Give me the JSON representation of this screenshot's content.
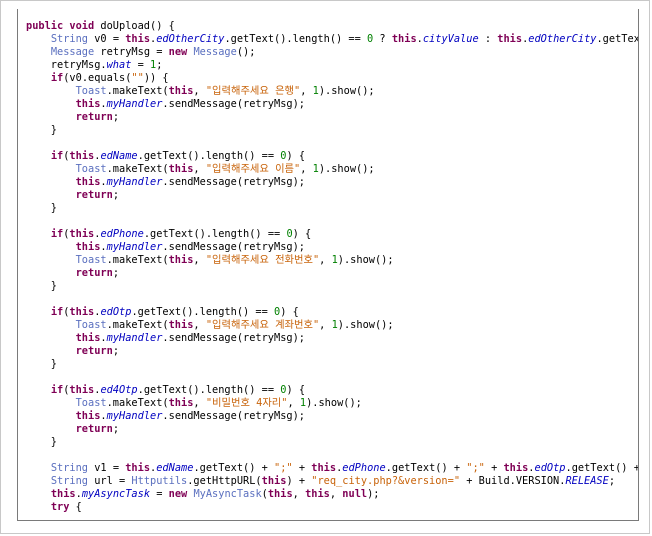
{
  "code_view": {
    "lines": [
      [
        {
          "c": "kw",
          "t": "public void"
        },
        {
          "c": "pl",
          "t": " doUpload() {"
        }
      ],
      [
        {
          "c": "pl",
          "t": "    "
        },
        {
          "c": "ty",
          "t": "String"
        },
        {
          "c": "pl",
          "t": " v0 = "
        },
        {
          "c": "kw",
          "t": "this"
        },
        {
          "c": "pl",
          "t": "."
        },
        {
          "c": "fld",
          "t": "edOtherCity"
        },
        {
          "c": "pl",
          "t": ".getText().length() == "
        },
        {
          "c": "num",
          "t": "0"
        },
        {
          "c": "pl",
          "t": " ? "
        },
        {
          "c": "kw",
          "t": "this"
        },
        {
          "c": "pl",
          "t": "."
        },
        {
          "c": "fld",
          "t": "cityValue"
        },
        {
          "c": "pl",
          "t": " : "
        },
        {
          "c": "kw",
          "t": "this"
        },
        {
          "c": "pl",
          "t": "."
        },
        {
          "c": "fld",
          "t": "edOtherCity"
        },
        {
          "c": "pl",
          "t": ".getText()"
        }
      ],
      [
        {
          "c": "pl",
          "t": "    "
        },
        {
          "c": "ty",
          "t": "Message"
        },
        {
          "c": "pl",
          "t": " retryMsg = "
        },
        {
          "c": "kw",
          "t": "new"
        },
        {
          "c": "pl",
          "t": " "
        },
        {
          "c": "ty",
          "t": "Message"
        },
        {
          "c": "pl",
          "t": "();"
        }
      ],
      [
        {
          "c": "pl",
          "t": "    retryMsg."
        },
        {
          "c": "fld",
          "t": "what"
        },
        {
          "c": "pl",
          "t": " = "
        },
        {
          "c": "num",
          "t": "1"
        },
        {
          "c": "pl",
          "t": ";"
        }
      ],
      [
        {
          "c": "pl",
          "t": "    "
        },
        {
          "c": "kw",
          "t": "if"
        },
        {
          "c": "pl",
          "t": "(v0.equals("
        },
        {
          "c": "str",
          "t": "\"\""
        },
        {
          "c": "pl",
          "t": ")) {"
        }
      ],
      [
        {
          "c": "pl",
          "t": "        "
        },
        {
          "c": "ty",
          "t": "Toast"
        },
        {
          "c": "pl",
          "t": ".makeText("
        },
        {
          "c": "kw",
          "t": "this"
        },
        {
          "c": "pl",
          "t": ", "
        },
        {
          "c": "str",
          "t": "\"입력해주세요 은행\""
        },
        {
          "c": "pl",
          "t": ", "
        },
        {
          "c": "num",
          "t": "1"
        },
        {
          "c": "pl",
          "t": ").show();"
        }
      ],
      [
        {
          "c": "pl",
          "t": "        "
        },
        {
          "c": "kw",
          "t": "this"
        },
        {
          "c": "pl",
          "t": "."
        },
        {
          "c": "fld",
          "t": "myHandler"
        },
        {
          "c": "pl",
          "t": ".sendMessage(retryMsg);"
        }
      ],
      [
        {
          "c": "pl",
          "t": "        "
        },
        {
          "c": "kw",
          "t": "return"
        },
        {
          "c": "pl",
          "t": ";"
        }
      ],
      [
        {
          "c": "pl",
          "t": "    }"
        }
      ],
      [],
      [
        {
          "c": "pl",
          "t": "    "
        },
        {
          "c": "kw",
          "t": "if"
        },
        {
          "c": "pl",
          "t": "("
        },
        {
          "c": "kw",
          "t": "this"
        },
        {
          "c": "pl",
          "t": "."
        },
        {
          "c": "fld",
          "t": "edName"
        },
        {
          "c": "pl",
          "t": ".getText().length() == "
        },
        {
          "c": "num",
          "t": "0"
        },
        {
          "c": "pl",
          "t": ") {"
        }
      ],
      [
        {
          "c": "pl",
          "t": "        "
        },
        {
          "c": "ty",
          "t": "Toast"
        },
        {
          "c": "pl",
          "t": ".makeText("
        },
        {
          "c": "kw",
          "t": "this"
        },
        {
          "c": "pl",
          "t": ", "
        },
        {
          "c": "str",
          "t": "\"입력해주세요 이름\""
        },
        {
          "c": "pl",
          "t": ", "
        },
        {
          "c": "num",
          "t": "1"
        },
        {
          "c": "pl",
          "t": ").show();"
        }
      ],
      [
        {
          "c": "pl",
          "t": "        "
        },
        {
          "c": "kw",
          "t": "this"
        },
        {
          "c": "pl",
          "t": "."
        },
        {
          "c": "fld",
          "t": "myHandler"
        },
        {
          "c": "pl",
          "t": ".sendMessage(retryMsg);"
        }
      ],
      [
        {
          "c": "pl",
          "t": "        "
        },
        {
          "c": "kw",
          "t": "return"
        },
        {
          "c": "pl",
          "t": ";"
        }
      ],
      [
        {
          "c": "pl",
          "t": "    }"
        }
      ],
      [],
      [
        {
          "c": "pl",
          "t": "    "
        },
        {
          "c": "kw",
          "t": "if"
        },
        {
          "c": "pl",
          "t": "("
        },
        {
          "c": "kw",
          "t": "this"
        },
        {
          "c": "pl",
          "t": "."
        },
        {
          "c": "fld",
          "t": "edPhone"
        },
        {
          "c": "pl",
          "t": ".getText().length() == "
        },
        {
          "c": "num",
          "t": "0"
        },
        {
          "c": "pl",
          "t": ") {"
        }
      ],
      [
        {
          "c": "pl",
          "t": "        "
        },
        {
          "c": "kw",
          "t": "this"
        },
        {
          "c": "pl",
          "t": "."
        },
        {
          "c": "fld",
          "t": "myHandler"
        },
        {
          "c": "pl",
          "t": ".sendMessage(retryMsg);"
        }
      ],
      [
        {
          "c": "pl",
          "t": "        "
        },
        {
          "c": "ty",
          "t": "Toast"
        },
        {
          "c": "pl",
          "t": ".makeText("
        },
        {
          "c": "kw",
          "t": "this"
        },
        {
          "c": "pl",
          "t": ", "
        },
        {
          "c": "str",
          "t": "\"입력해주세요 전화번호\""
        },
        {
          "c": "pl",
          "t": ", "
        },
        {
          "c": "num",
          "t": "1"
        },
        {
          "c": "pl",
          "t": ").show();"
        }
      ],
      [
        {
          "c": "pl",
          "t": "        "
        },
        {
          "c": "kw",
          "t": "return"
        },
        {
          "c": "pl",
          "t": ";"
        }
      ],
      [
        {
          "c": "pl",
          "t": "    }"
        }
      ],
      [],
      [
        {
          "c": "pl",
          "t": "    "
        },
        {
          "c": "kw",
          "t": "if"
        },
        {
          "c": "pl",
          "t": "("
        },
        {
          "c": "kw",
          "t": "this"
        },
        {
          "c": "pl",
          "t": "."
        },
        {
          "c": "fld",
          "t": "edOtp"
        },
        {
          "c": "pl",
          "t": ".getText().length() == "
        },
        {
          "c": "num",
          "t": "0"
        },
        {
          "c": "pl",
          "t": ") {"
        }
      ],
      [
        {
          "c": "pl",
          "t": "        "
        },
        {
          "c": "ty",
          "t": "Toast"
        },
        {
          "c": "pl",
          "t": ".makeText("
        },
        {
          "c": "kw",
          "t": "this"
        },
        {
          "c": "pl",
          "t": ", "
        },
        {
          "c": "str",
          "t": "\"입력해주세요 계좌번호\""
        },
        {
          "c": "pl",
          "t": ", "
        },
        {
          "c": "num",
          "t": "1"
        },
        {
          "c": "pl",
          "t": ").show();"
        }
      ],
      [
        {
          "c": "pl",
          "t": "        "
        },
        {
          "c": "kw",
          "t": "this"
        },
        {
          "c": "pl",
          "t": "."
        },
        {
          "c": "fld",
          "t": "myHandler"
        },
        {
          "c": "pl",
          "t": ".sendMessage(retryMsg);"
        }
      ],
      [
        {
          "c": "pl",
          "t": "        "
        },
        {
          "c": "kw",
          "t": "return"
        },
        {
          "c": "pl",
          "t": ";"
        }
      ],
      [
        {
          "c": "pl",
          "t": "    }"
        }
      ],
      [],
      [
        {
          "c": "pl",
          "t": "    "
        },
        {
          "c": "kw",
          "t": "if"
        },
        {
          "c": "pl",
          "t": "("
        },
        {
          "c": "kw",
          "t": "this"
        },
        {
          "c": "pl",
          "t": "."
        },
        {
          "c": "fld",
          "t": "ed4Otp"
        },
        {
          "c": "pl",
          "t": ".getText().length() == "
        },
        {
          "c": "num",
          "t": "0"
        },
        {
          "c": "pl",
          "t": ") {"
        }
      ],
      [
        {
          "c": "pl",
          "t": "        "
        },
        {
          "c": "ty",
          "t": "Toast"
        },
        {
          "c": "pl",
          "t": ".makeText("
        },
        {
          "c": "kw",
          "t": "this"
        },
        {
          "c": "pl",
          "t": ", "
        },
        {
          "c": "str",
          "t": "\"비밀번호 4자리\""
        },
        {
          "c": "pl",
          "t": ", "
        },
        {
          "c": "num",
          "t": "1"
        },
        {
          "c": "pl",
          "t": ").show();"
        }
      ],
      [
        {
          "c": "pl",
          "t": "        "
        },
        {
          "c": "kw",
          "t": "this"
        },
        {
          "c": "pl",
          "t": "."
        },
        {
          "c": "fld",
          "t": "myHandler"
        },
        {
          "c": "pl",
          "t": ".sendMessage(retryMsg);"
        }
      ],
      [
        {
          "c": "pl",
          "t": "        "
        },
        {
          "c": "kw",
          "t": "return"
        },
        {
          "c": "pl",
          "t": ";"
        }
      ],
      [
        {
          "c": "pl",
          "t": "    }"
        }
      ],
      [],
      [
        {
          "c": "pl",
          "t": "    "
        },
        {
          "c": "ty",
          "t": "String"
        },
        {
          "c": "pl",
          "t": " v1 = "
        },
        {
          "c": "kw",
          "t": "this"
        },
        {
          "c": "pl",
          "t": "."
        },
        {
          "c": "fld",
          "t": "edName"
        },
        {
          "c": "pl",
          "t": ".getText() + "
        },
        {
          "c": "str",
          "t": "\";\""
        },
        {
          "c": "pl",
          "t": " + "
        },
        {
          "c": "kw",
          "t": "this"
        },
        {
          "c": "pl",
          "t": "."
        },
        {
          "c": "fld",
          "t": "edPhone"
        },
        {
          "c": "pl",
          "t": ".getText() + "
        },
        {
          "c": "str",
          "t": "\";\""
        },
        {
          "c": "pl",
          "t": " + "
        },
        {
          "c": "kw",
          "t": "this"
        },
        {
          "c": "pl",
          "t": "."
        },
        {
          "c": "fld",
          "t": "edOtp"
        },
        {
          "c": "pl",
          "t": ".getText() + "
        },
        {
          "c": "str",
          "t": "\";"
        }
      ],
      [
        {
          "c": "pl",
          "t": "    "
        },
        {
          "c": "ty",
          "t": "String"
        },
        {
          "c": "pl",
          "t": " url = "
        },
        {
          "c": "ty",
          "t": "Httputils"
        },
        {
          "c": "pl",
          "t": ".getHttpURL("
        },
        {
          "c": "kw",
          "t": "this"
        },
        {
          "c": "pl",
          "t": ") + "
        },
        {
          "c": "str",
          "t": "\"req_city.php?&version=\""
        },
        {
          "c": "pl",
          "t": " + Build.VERSION."
        },
        {
          "c": "fld",
          "t": "RELEASE"
        },
        {
          "c": "pl",
          "t": ";"
        }
      ],
      [
        {
          "c": "pl",
          "t": "    "
        },
        {
          "c": "kw",
          "t": "this"
        },
        {
          "c": "pl",
          "t": "."
        },
        {
          "c": "fld",
          "t": "myAsyncTask"
        },
        {
          "c": "pl",
          "t": " = "
        },
        {
          "c": "kw",
          "t": "new"
        },
        {
          "c": "pl",
          "t": " "
        },
        {
          "c": "ty",
          "t": "MyAsyncTask"
        },
        {
          "c": "pl",
          "t": "("
        },
        {
          "c": "kw",
          "t": "this"
        },
        {
          "c": "pl",
          "t": ", "
        },
        {
          "c": "kw",
          "t": "this"
        },
        {
          "c": "pl",
          "t": ", "
        },
        {
          "c": "kw",
          "t": "null"
        },
        {
          "c": "pl",
          "t": ");"
        }
      ],
      [
        {
          "c": "pl",
          "t": "    "
        },
        {
          "c": "kw",
          "t": "try"
        },
        {
          "c": "pl",
          "t": " {"
        }
      ]
    ]
  }
}
